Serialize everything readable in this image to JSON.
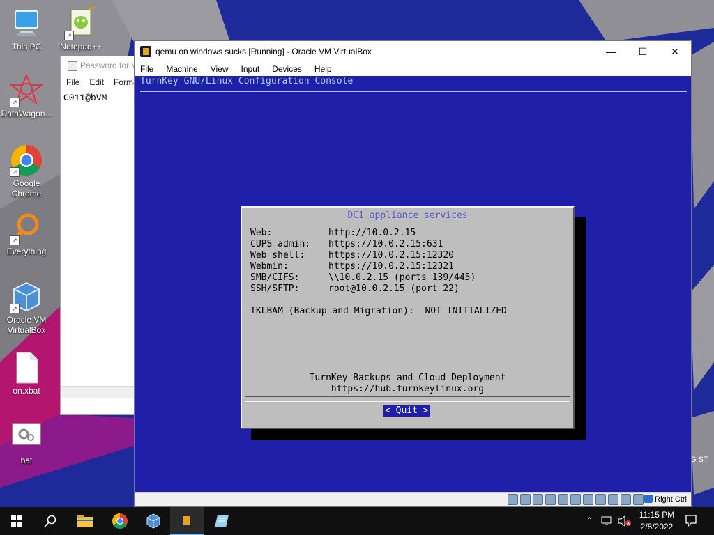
{
  "desktop": {
    "icons": [
      {
        "label": "This PC",
        "icon": "computer-icon"
      },
      {
        "label": "Notepad++",
        "icon": "notepadpp-icon"
      },
      {
        "label": "DataWagon...",
        "icon": "datawagon-icon"
      },
      {
        "label": "Google Chrome",
        "icon": "chrome-icon"
      },
      {
        "label": "Everything",
        "icon": "search-icon"
      },
      {
        "label": "Oracle VM VirtualBox",
        "icon": "virtualbox-icon"
      },
      {
        "label": "on.xbat",
        "icon": "file-icon"
      },
      {
        "label": "bat",
        "icon": "gear-file-icon"
      }
    ],
    "background_text": "G ST"
  },
  "notepad": {
    "title": "Password for V",
    "menu": [
      "File",
      "Edit",
      "Forma"
    ],
    "content": "C011@bVM"
  },
  "vbox_window": {
    "title": "qemu on windows sucks [Running] - Oracle VM VirtualBox",
    "controls": {
      "minimize": "—",
      "maximize": "☐",
      "close": "✕"
    },
    "menu": [
      "File",
      "Machine",
      "View",
      "Input",
      "Devices",
      "Help"
    ],
    "host_key": "Right Ctrl"
  },
  "console": {
    "title": "TurnKey GNU/Linux Configuration Console",
    "dialog": {
      "title": "DC1 appliance services",
      "services": [
        {
          "name": "Web:",
          "value": "http://10.0.2.15"
        },
        {
          "name": "CUPS admin:",
          "value": "https://10.0.2.15:631"
        },
        {
          "name": "Web shell:",
          "value": "https://10.0.2.15:12320"
        },
        {
          "name": "Webmin:",
          "value": "https://10.0.2.15:12321"
        },
        {
          "name": "SMB/CIFS:",
          "value": "\\\\10.0.2.15 (ports 139/445)"
        },
        {
          "name": "SSH/SFTP:",
          "value": "root@10.0.2.15 (port 22)"
        }
      ],
      "tklbam": "TKLBAM (Backup and Migration):  NOT INITIALIZED",
      "footer_line1": "TurnKey Backups and Cloud Deployment",
      "footer_line2": "https://hub.turnkeylinux.org",
      "quit_button": "< Quit >"
    }
  },
  "taskbar": {
    "time": "11:15 PM",
    "date": "2/8/2022",
    "items": [
      "start-button",
      "search-button",
      "file-explorer",
      "chrome",
      "virtualbox",
      "qemu-app",
      "notepad-app"
    ]
  },
  "colors": {
    "console_bg": "#1f1faa",
    "console_fg": "#9ed6f2",
    "dialog_bg": "#bebebe",
    "dialog_title": "#5a5ad6",
    "taskbar_bg": "#101010"
  }
}
